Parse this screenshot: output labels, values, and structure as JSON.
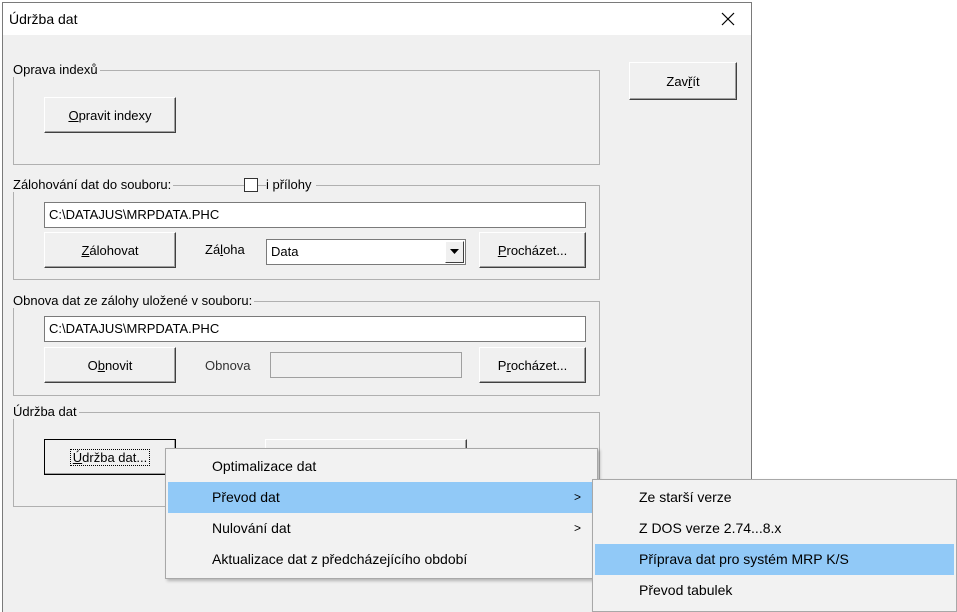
{
  "window": {
    "title": "Údržba dat",
    "close_icon": "close-icon"
  },
  "close_button": {
    "label_pre": "Zav",
    "label_under": "ř",
    "label_post": "ít"
  },
  "oprava": {
    "group_label": "Oprava indexů",
    "button_under": "O",
    "button_rest": "pravit indexy"
  },
  "zalohovani": {
    "group_label": "Zálohování dat do souboru:",
    "checkbox_label": "i přílohy",
    "checkbox_checked": false,
    "path": "C:\\DATAJUS\\MRPDATA.PHC",
    "button_under": "Z",
    "button_rest": "álohovat",
    "zaloha_label_pre": "Zá",
    "zaloha_label_under": "l",
    "zaloha_label_post": "oha",
    "zaloha_value": "Data",
    "browse_under": "P",
    "browse_rest": "rocházet..."
  },
  "obnova": {
    "group_label": "Obnova dat ze zálohy uložené v souboru:",
    "path": "C:\\DATAJUS\\MRPDATA.PHC",
    "button_pre": "O",
    "button_under": "b",
    "button_post": "novit",
    "obnova_label": "Obnova",
    "obnova_value": "",
    "browse_pre": "P",
    "browse_under": "r",
    "browse_post": "ocházet..."
  },
  "udrzba": {
    "group_label": "Údržba dat",
    "button_under": "Ú",
    "button_rest": "držba dat..."
  },
  "context_menu": {
    "items": [
      {
        "label": "Optimalizace dat",
        "submenu": false,
        "highlighted": false
      },
      {
        "label": "Převod dat",
        "submenu": true,
        "highlighted": true
      },
      {
        "label": "Nulování dat",
        "submenu": true,
        "highlighted": false
      },
      {
        "label": "Aktualizace dat z předcházejícího období",
        "submenu": false,
        "highlighted": false
      }
    ],
    "arrow_glyph": ">"
  },
  "submenu": {
    "items": [
      {
        "label": "Ze starší verze",
        "highlighted": false
      },
      {
        "label": "Z DOS verze 2.74...8.x",
        "highlighted": false
      },
      {
        "label": "Příprava dat pro systém MRP K/S",
        "highlighted": true
      },
      {
        "label": "Převod tabulek",
        "highlighted": false
      }
    ]
  },
  "colors": {
    "highlight": "#91c9f7",
    "dialog_bg": "#f0f0f0",
    "menu_bg": "#f2f2f2"
  }
}
